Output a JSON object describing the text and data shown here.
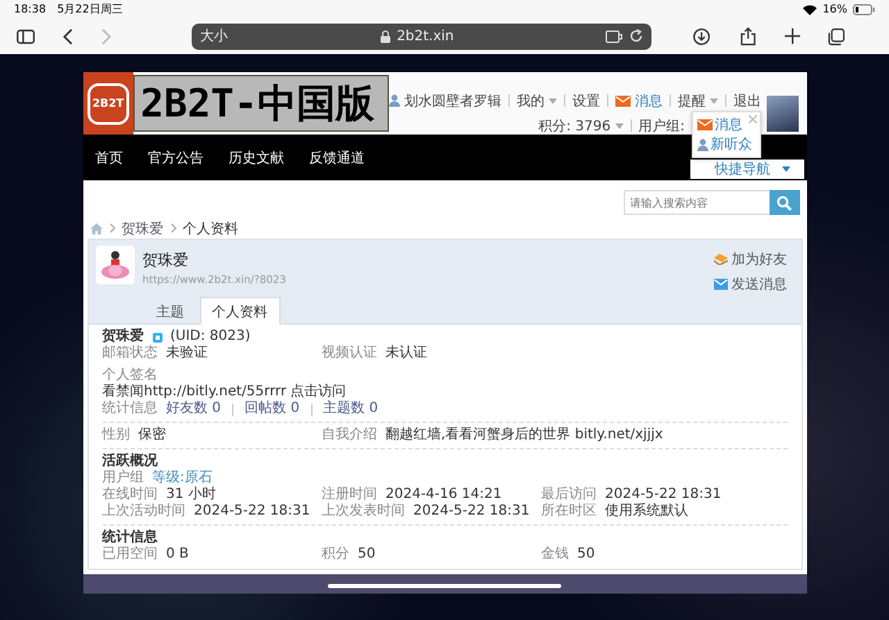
{
  "status_bar": {
    "time": "18:38",
    "date": "5月22日周三",
    "battery": "16%"
  },
  "browser": {
    "text_size": "大小",
    "url": "2b2t.xin",
    "back": {
      "disabled": false
    },
    "forward": {
      "disabled": true
    }
  },
  "header": {
    "logo_badge": "2B2T",
    "title": "2B2T-中国版",
    "user_links": [
      {
        "label": "划水圆壁者罗辑",
        "kind": "user"
      },
      {
        "label": "我的",
        "kind": "menu"
      },
      {
        "label": "设置",
        "kind": "link"
      },
      {
        "label": "消息",
        "kind": "mail"
      },
      {
        "label": "提醒",
        "kind": "menu"
      },
      {
        "label": "退出",
        "kind": "link"
      }
    ],
    "points": "积分: 3796",
    "usergroup": "用户组:",
    "popup": [
      {
        "label": "消息",
        "kind": "mail"
      },
      {
        "label": "新听众",
        "kind": "user"
      }
    ]
  },
  "nav": {
    "items": [
      "首页",
      "官方公告",
      "历史文献",
      "反馈通道"
    ],
    "quick_nav": "快捷导航"
  },
  "search": {
    "placeholder": "请输入搜索内容"
  },
  "breadcrumb": [
    "贺珠爱",
    "个人资料"
  ],
  "profile": {
    "name": "贺珠爱",
    "url": "https://www.2b2t.xin/?8023",
    "actions": [
      {
        "label": "加为好友",
        "kind": "friend"
      },
      {
        "label": "发送消息",
        "kind": "mail"
      }
    ],
    "tabs": [
      {
        "label": "主题",
        "selected": false
      },
      {
        "label": "个人资料",
        "selected": true
      }
    ]
  },
  "details": {
    "name": "贺珠爱",
    "uid": "(UID: 8023)",
    "verify": [
      {
        "label": "邮箱状态",
        "value": "未验证"
      },
      {
        "label": "视频认证",
        "value": "未认证"
      }
    ],
    "signature_label": "个人签名",
    "signature": "看禁闻http://bitly.net/55rrrr 点击访问",
    "stats_label": "统计信息",
    "stats_links": [
      "好友数 0",
      "回帖数 0",
      "主题数 0"
    ],
    "personal": [
      {
        "label": "性别",
        "value": "保密"
      },
      {
        "label": "自我介绍",
        "value": "翻越红墙,看看河蟹身后的世界 bitly.net/xjjjx"
      }
    ]
  },
  "activity": {
    "title": "活跃概况",
    "usergroup_label": "用户组",
    "usergroup": "等级:原石",
    "fields": [
      {
        "label": "在线时间",
        "value": "31 小时"
      },
      {
        "label": "注册时间",
        "value": "2024-4-16 14:21"
      },
      {
        "label": "最后访问",
        "value": "2024-5-22 18:31"
      },
      {
        "label": "上次活动时间",
        "value": "2024-5-22 18:31"
      },
      {
        "label": "上次发表时间",
        "value": "2024-5-22 18:31"
      },
      {
        "label": "所在时区",
        "value": "使用系统默认"
      }
    ]
  },
  "statistics": {
    "title": "统计信息",
    "fields": [
      {
        "label": "已用空间",
        "value": "0 B"
      },
      {
        "label": "积分",
        "value": "50"
      },
      {
        "label": "金钱",
        "value": "50"
      }
    ]
  }
}
